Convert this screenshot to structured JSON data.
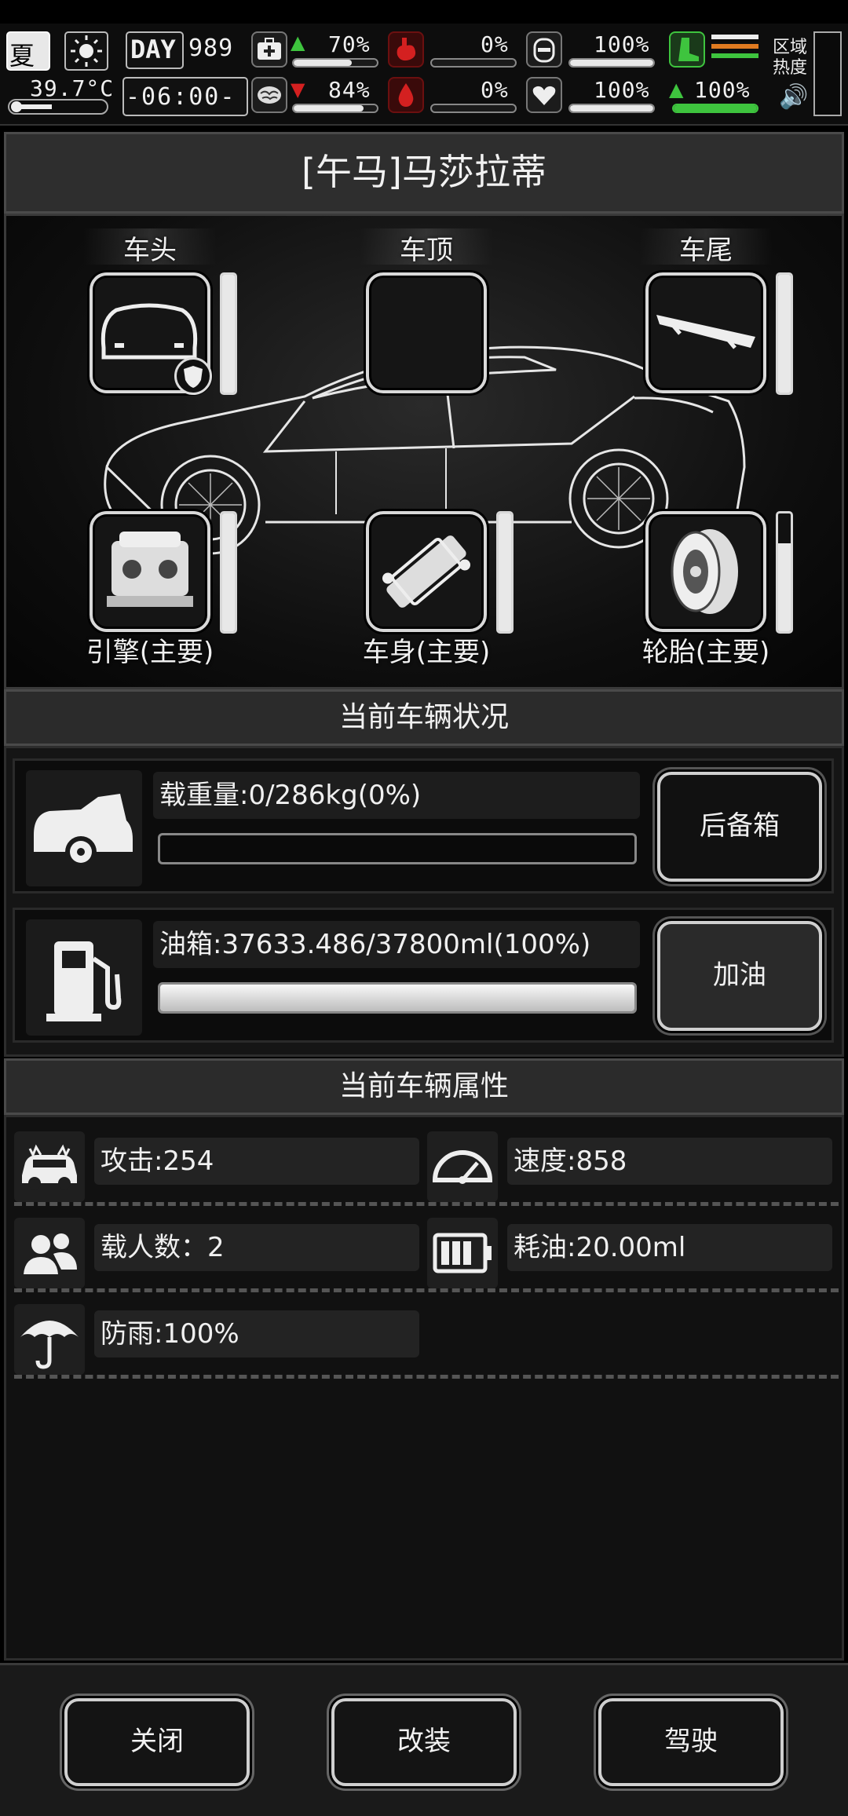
{
  "status": {
    "season": "夏",
    "temperature": "39.7°C",
    "day_label": "DAY",
    "day_number": "989",
    "clock": "-06:00-",
    "health_pct": "70%",
    "health_level": 0.7,
    "mood_pct": "84%",
    "mood_level": 0.84,
    "hunger_pct": "0%",
    "hunger_level": 0.0,
    "thirst_pct": "0%",
    "thirst_level": 0.0,
    "armor_pct": "100%",
    "armor_level": 1.0,
    "heart_pct": "100%",
    "heart_level": 1.0,
    "stamina_pct": "100%",
    "stamina_level": 1.0,
    "zone_heat_label": "区域热度",
    "zone_heat_line1": "区域",
    "zone_heat_line2": "热度"
  },
  "car": {
    "title": "[午马]马莎拉蒂"
  },
  "parts": {
    "front": {
      "label": "车头",
      "level": 1.0
    },
    "roof": {
      "label": "车顶"
    },
    "rear": {
      "label": "车尾",
      "level": 1.0
    },
    "engine": {
      "label": "引擎(主要)",
      "level": 1.0
    },
    "body": {
      "label": "车身(主要)",
      "level": 1.0
    },
    "tires": {
      "label": "轮胎(主要)",
      "level": 0.75
    }
  },
  "vehicle_status": {
    "heading": "当前车辆状况",
    "cargo_label": "载重量:0/286kg(0%)",
    "cargo_level": 0.0,
    "trunk_button": "后备箱",
    "fuel_label": "油箱:37633.486/37800ml(100%)",
    "fuel_level": 1.0,
    "refuel_button": "加油"
  },
  "vehicle_attrs": {
    "heading": "当前车辆属性",
    "attack": "攻击:254",
    "speed": "速度:858",
    "seats": "载人数：2",
    "fuel_use": "耗油:20.00ml",
    "rainproof": "防雨:100%"
  },
  "footer": {
    "close": "关闭",
    "modify": "改装",
    "drive": "驾驶"
  },
  "colors": {
    "accent_green": "#3ec43e",
    "alert_red": "#d42020"
  }
}
